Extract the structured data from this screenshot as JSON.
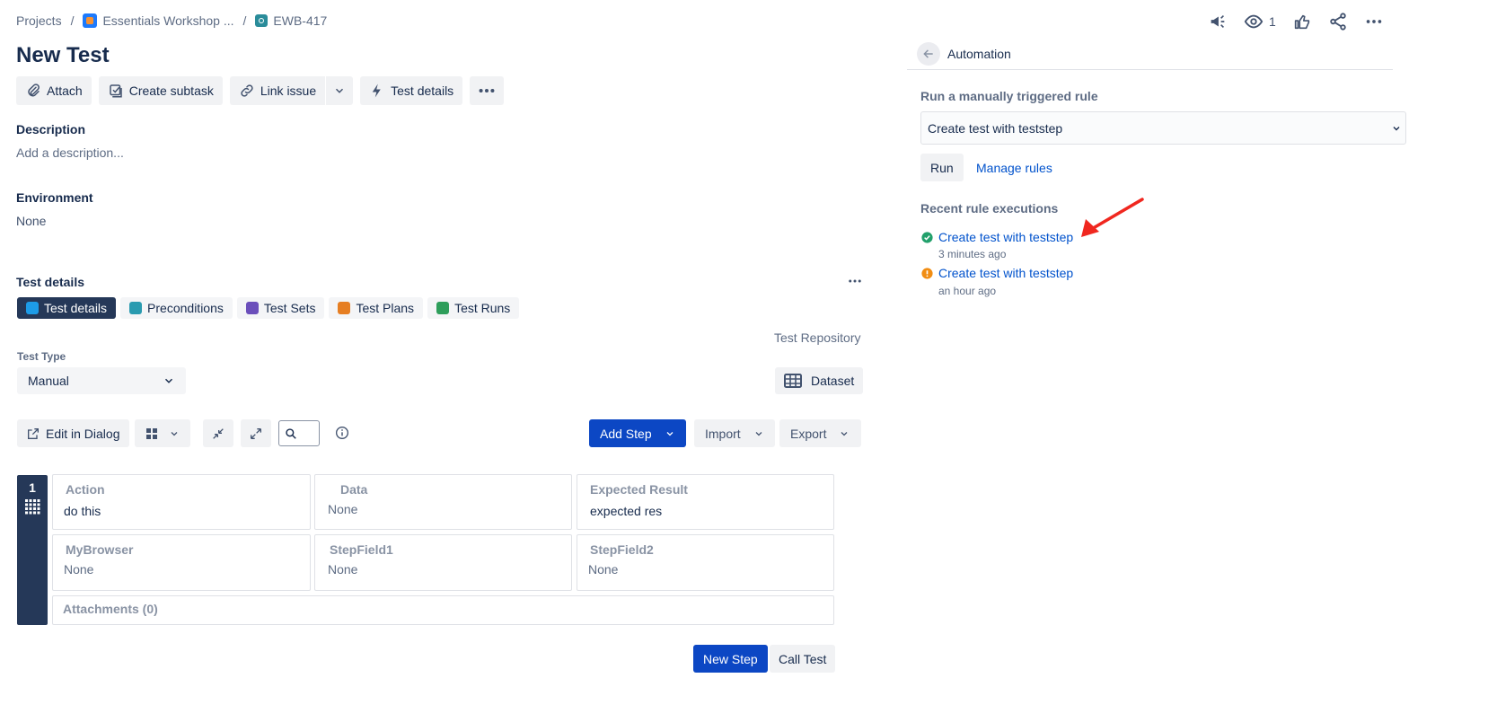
{
  "breadcrumb": {
    "projects": "Projects",
    "project": "Essentials Workshop ...",
    "issue": "EWB-417"
  },
  "header": {
    "watch_count": "1"
  },
  "issue": {
    "title": "New Test",
    "actions": {
      "attach": "Attach",
      "create_subtask": "Create subtask",
      "link_issue": "Link issue",
      "test_details": "Test details"
    },
    "description": {
      "label": "Description",
      "placeholder": "Add a description..."
    },
    "environment": {
      "label": "Environment",
      "value": "None"
    }
  },
  "test_details": {
    "title": "Test details",
    "tabs": [
      {
        "label": "Test details",
        "color": "#1d9ce8"
      },
      {
        "label": "Preconditions",
        "color": "#2a9bb0"
      },
      {
        "label": "Test Sets",
        "color": "#6b4fbb"
      },
      {
        "label": "Test Plans",
        "color": "#e67e22"
      },
      {
        "label": "Test Runs",
        "color": "#2e9e5b"
      }
    ],
    "repository": "Test Repository",
    "test_type_label": "Test Type",
    "test_type_value": "Manual",
    "dataset": "Dataset",
    "toolbar": {
      "edit_in_dialog": "Edit in Dialog",
      "add_step": "Add Step",
      "import": "Import",
      "export": "Export"
    },
    "step": {
      "number": "1",
      "action_label": "Action",
      "action_value": "do this",
      "data_label": "Data",
      "data_value": "None",
      "expected_label": "Expected Result",
      "expected_value": "expected res",
      "mybrowser_label": "MyBrowser",
      "mybrowser_value": "None",
      "stepfield1_label": "StepField1",
      "stepfield1_value": "None",
      "stepfield2_label": "StepField2",
      "stepfield2_value": "None",
      "attachments": "Attachments (0)"
    },
    "new_step": "New Step",
    "call_test": "Call Test"
  },
  "automation": {
    "title": "Automation",
    "run_label": "Run a manually triggered rule",
    "rule_selected": "Create test with teststep",
    "run_button": "Run",
    "manage_rules": "Manage rules",
    "recent_label": "Recent rule executions",
    "executions": [
      {
        "name": "Create test with teststep",
        "time": "3 minutes ago",
        "status": "success",
        "color": "#22a06b"
      },
      {
        "name": "Create test with teststep",
        "time": "an hour ago",
        "status": "warning",
        "color": "#f18d13"
      }
    ]
  },
  "colors": {
    "primary": "#0c47c4",
    "link": "#0052cc",
    "annotation_arrow": "#f0271f"
  }
}
